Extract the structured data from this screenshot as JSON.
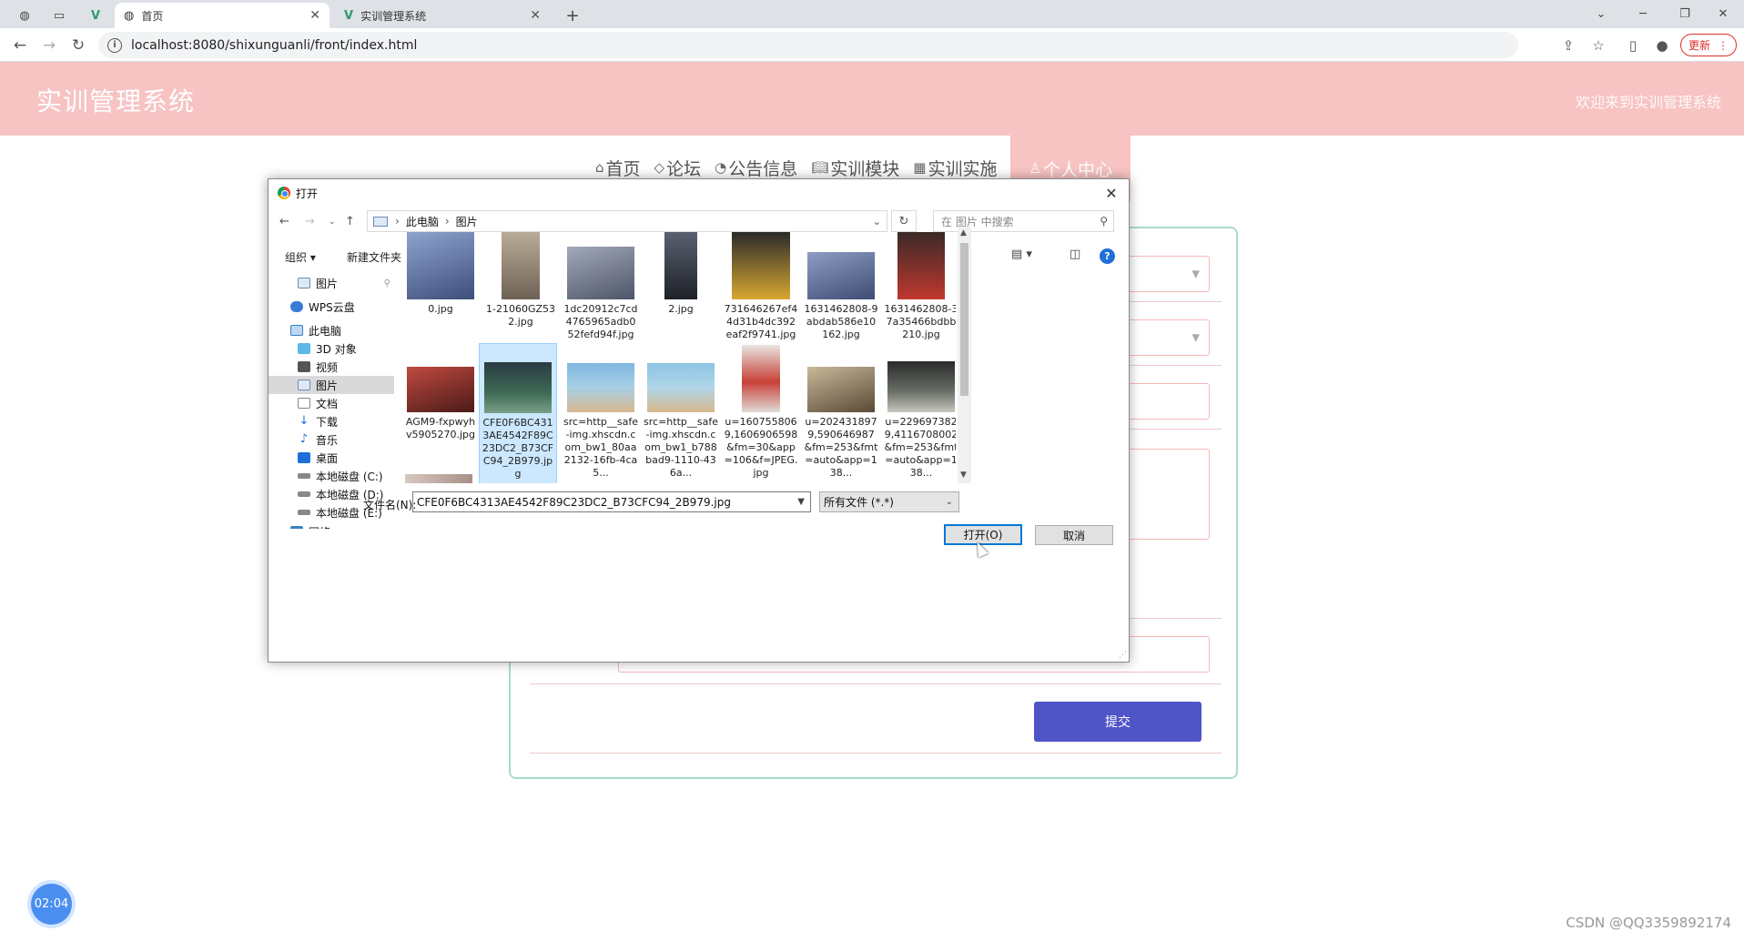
{
  "browser": {
    "tabs": [
      {
        "label": "首页",
        "active": true
      },
      {
        "label": "实训管理系统",
        "active": false
      }
    ],
    "url": "localhost:8080/shixunguanli/front/index.html",
    "update_label": "更新"
  },
  "site": {
    "title": "实训管理系统",
    "welcome": "欢迎来到实训管理系统",
    "nav": [
      {
        "label": "首页",
        "icon": "home-icon"
      },
      {
        "label": "论坛",
        "icon": "tag-icon"
      },
      {
        "label": "公告信息",
        "icon": "gauge-icon"
      },
      {
        "label": "实训模块",
        "icon": "book-icon"
      },
      {
        "label": "实训实施",
        "icon": "grid-icon"
      },
      {
        "label": "个人中心",
        "icon": "user-icon",
        "active": true
      }
    ],
    "submit_label": "提交",
    "timer": "02:04",
    "watermark": "CSDN @QQ3359892174"
  },
  "dialog": {
    "title": "打开",
    "breadcrumb": [
      "此电脑",
      "图片"
    ],
    "search_placeholder": "在 图片 中搜索",
    "organize": "组织",
    "new_folder": "新建文件夹",
    "tree": [
      {
        "label": "图片",
        "icon": "pictures-icon",
        "pinned": true
      },
      {
        "label": "WPS云盘",
        "icon": "cloud-icon"
      },
      {
        "label": "此电脑",
        "icon": "computer-icon"
      },
      {
        "label": "3D 对象",
        "icon": "cube-icon"
      },
      {
        "label": "视频",
        "icon": "video-icon"
      },
      {
        "label": "图片",
        "icon": "pictures-icon",
        "selected": true
      },
      {
        "label": "文档",
        "icon": "document-icon"
      },
      {
        "label": "下载",
        "icon": "download-icon"
      },
      {
        "label": "音乐",
        "icon": "music-icon"
      },
      {
        "label": "桌面",
        "icon": "desktop-icon"
      },
      {
        "label": "本地磁盘 (C:)",
        "icon": "drive-icon"
      },
      {
        "label": "本地磁盘 (D:)",
        "icon": "drive-icon"
      },
      {
        "label": "本地磁盘 (E:)",
        "icon": "drive-icon"
      },
      {
        "label": "网络",
        "icon": "network-icon"
      }
    ],
    "files": [
      {
        "name": "0.jpg",
        "color": "#6a7fb0"
      },
      {
        "name": "1-21060GZ532.jpg",
        "color": "#9a8a78"
      },
      {
        "name": "1dc20912c7cd4765965adb052fefd94f.jpg",
        "color": "#8894a8"
      },
      {
        "name": "2.jpg",
        "color": "#3a3f4a"
      },
      {
        "name": "731646267ef44d31b4dc392eaf2f9741.jpg",
        "color": "#c9a030"
      },
      {
        "name": "1631462808-9abdab586e10162.jpg",
        "color": "#6e7ea8"
      },
      {
        "name": "1631462808-37a35466bdbb210.jpg",
        "color": "#b0302a"
      },
      {
        "name": "AGM9-fxpwyhv5905270.jpg",
        "color": "#a03028"
      },
      {
        "name": "CFE0F6BC4313AE4542F89C23DC2_B73CFC94_2B979.jpg",
        "color": "#3e6a55",
        "selected": true
      },
      {
        "name": "src=http__safe-img.xhscdn.com_bw1_80aa2132-16fb-4ca5...",
        "color": "#7fb8d8"
      },
      {
        "name": "src=http__safe-img.xhscdn.com_bw1_b788bad9-1110-436a...",
        "color": "#8cc4dc"
      },
      {
        "name": "u=1607558069,1606906598&fm=30&app=106&f=JPEG.jpg",
        "color": "#d8d0c8"
      },
      {
        "name": "u=2024318979,590646987&fm=253&fmt=auto&app=138...",
        "color": "#8a7a60"
      },
      {
        "name": "u=2296973829,4116708002&fm=253&fmt=auto&app=138...",
        "color": "#505a50"
      }
    ],
    "filename_label": "文件名(N):",
    "filename_value": "CFE0F6BC4313AE4542F89C23DC2_B73CFC94_2B979.jpg",
    "filetype": "所有文件 (*.*)",
    "open_label": "打开(O)",
    "cancel_label": "取消"
  }
}
